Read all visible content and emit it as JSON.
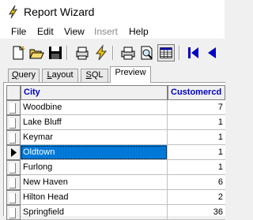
{
  "window": {
    "title": "Report Wizard"
  },
  "menu": [
    {
      "label": "File",
      "enabled": true
    },
    {
      "label": "Edit",
      "enabled": true
    },
    {
      "label": "View",
      "enabled": true
    },
    {
      "label": "Insert",
      "enabled": false
    },
    {
      "label": "Help",
      "enabled": true
    }
  ],
  "toolbar": {
    "buttons": [
      "new-icon",
      "open-folder-icon",
      "save-disk-icon",
      "print-preview-icon",
      "lightning-icon",
      "printer-icon",
      "magnifier-page-icon",
      "grid-view-icon",
      "first-record-icon",
      "previous-record-icon"
    ],
    "active": "grid-view-icon"
  },
  "tabs": [
    {
      "label": "Query",
      "u": "Q",
      "rest": "uery"
    },
    {
      "label": "Layout",
      "u": "L",
      "rest": "ayout"
    },
    {
      "label": "SQL",
      "u": "S",
      "rest": "QL"
    },
    {
      "label": "Preview",
      "u": "",
      "rest": "Preview",
      "active": true
    }
  ],
  "grid": {
    "columns": [
      "City",
      "Customercd"
    ],
    "rows": [
      {
        "city": "Woodbine",
        "count": "7"
      },
      {
        "city": "Lake Bluff",
        "count": "1"
      },
      {
        "city": "Keymar",
        "count": "1"
      },
      {
        "city": "Oldtown",
        "count": "1",
        "selected": true
      },
      {
        "city": "Furlong",
        "count": "1"
      },
      {
        "city": "New Haven",
        "count": "6"
      },
      {
        "city": "Hilton Head",
        "count": "2"
      },
      {
        "city": "Springfield",
        "count": "36"
      }
    ]
  },
  "colors": {
    "header_text": "#0000c0",
    "selection": "#0078d7"
  }
}
